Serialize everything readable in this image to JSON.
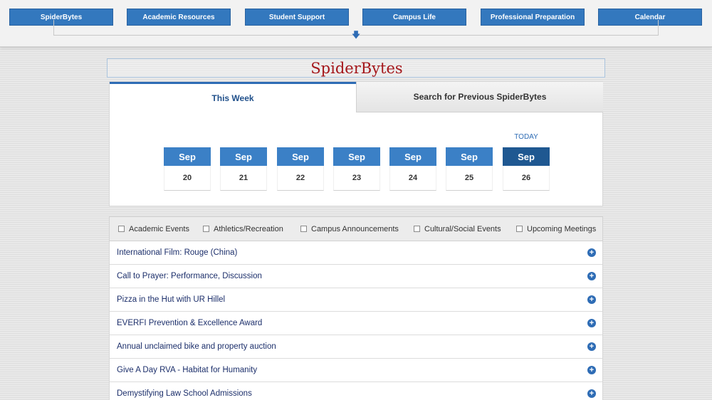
{
  "nav": {
    "items": [
      {
        "label": "SpiderBytes"
      },
      {
        "label": "Academic Resources"
      },
      {
        "label": "Student Support"
      },
      {
        "label": "Campus Life"
      },
      {
        "label": "Professional Preparation"
      },
      {
        "label": "Calendar"
      }
    ],
    "expand_icon": "arrow-down-icon"
  },
  "site": {
    "title": "SpiderBytes"
  },
  "tabs": [
    {
      "label": "This Week",
      "active": true
    },
    {
      "label": "Search for Previous SpiderBytes",
      "active": false
    }
  ],
  "calendar": {
    "today_label": "TODAY",
    "days": [
      {
        "month": "Sep",
        "day": "20"
      },
      {
        "month": "Sep",
        "day": "21"
      },
      {
        "month": "Sep",
        "day": "22"
      },
      {
        "month": "Sep",
        "day": "23"
      },
      {
        "month": "Sep",
        "day": "24"
      },
      {
        "month": "Sep",
        "day": "25"
      },
      {
        "month": "Sep",
        "day": "26",
        "today": true
      }
    ]
  },
  "filters": [
    {
      "label": "Academic Events"
    },
    {
      "label": "Athletics/Recreation"
    },
    {
      "label": "Campus Announcements"
    },
    {
      "label": "Cultural/Social Events"
    },
    {
      "label": "Upcoming Meetings"
    }
  ],
  "events": [
    {
      "title": "International Film: Rouge (China)",
      "icon": "plus-circle-icon",
      "icon_glyph": "+"
    },
    {
      "title": "Call to Prayer: Performance, Discussion",
      "icon": "plus-circle-icon",
      "icon_glyph": "+"
    },
    {
      "title": "Pizza in the Hut with UR Hillel",
      "icon": "plus-circle-icon",
      "icon_glyph": "+"
    },
    {
      "title": "EVERFI Prevention & Excellence Award",
      "icon": "plus-circle-icon",
      "icon_glyph": "+"
    },
    {
      "title": "Annual unclaimed bike and property auction",
      "icon": "plus-circle-icon",
      "icon_glyph": "+"
    },
    {
      "title": "Give A Day RVA - Habitat for Humanity",
      "icon": "plus-circle-icon",
      "icon_glyph": "+"
    },
    {
      "title": "Demystifying Law School Admissions",
      "icon": "plus-circle-icon",
      "icon_glyph": "+"
    }
  ],
  "colors": {
    "nav_button": "#3378be",
    "title_red": "#a4161a",
    "day_header": "#3b80c6",
    "today_header": "#1f5891",
    "event_text": "#1c2f6b"
  }
}
